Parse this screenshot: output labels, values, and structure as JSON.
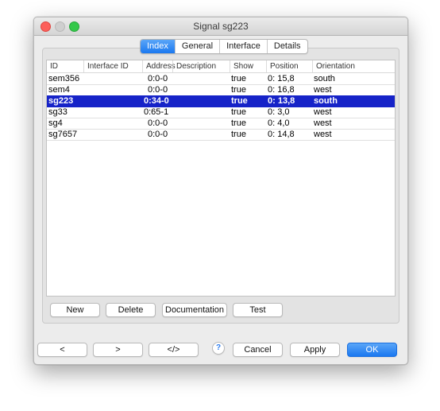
{
  "window": {
    "title": "Signal sg223"
  },
  "tabs": [
    {
      "label": "Index",
      "active": true
    },
    {
      "label": "General",
      "active": false
    },
    {
      "label": "Interface",
      "active": false
    },
    {
      "label": "Details",
      "active": false
    }
  ],
  "table": {
    "columns": [
      "ID",
      "Interface ID",
      "Address",
      "Description",
      "Show",
      "Position",
      "Orientation"
    ],
    "rows": [
      {
        "id": "sem356",
        "interface_id": "",
        "address": "0:0-0",
        "description": "",
        "show": "true",
        "position": "0: 15,8",
        "orientation": "south",
        "selected": false
      },
      {
        "id": "sem4",
        "interface_id": "",
        "address": "0:0-0",
        "description": "",
        "show": "true",
        "position": "0: 16,8",
        "orientation": "west",
        "selected": false
      },
      {
        "id": "sg223",
        "interface_id": "",
        "address": "0:34-0",
        "description": "",
        "show": "true",
        "position": "0: 13,8",
        "orientation": "south",
        "selected": true
      },
      {
        "id": "sg33",
        "interface_id": "",
        "address": "0:65-1",
        "description": "",
        "show": "true",
        "position": "0: 3,0",
        "orientation": "west",
        "selected": false
      },
      {
        "id": "sg4",
        "interface_id": "",
        "address": "0:0-0",
        "description": "",
        "show": "true",
        "position": "0: 4,0",
        "orientation": "west",
        "selected": false
      },
      {
        "id": "sg7657",
        "interface_id": "",
        "address": "0:0-0",
        "description": "",
        "show": "true",
        "position": "0: 14,8",
        "orientation": "west",
        "selected": false
      }
    ]
  },
  "table_actions": {
    "new": "New",
    "delete": "Delete",
    "documentation": "Documentation",
    "test": "Test"
  },
  "footer": {
    "prev": "<",
    "next": ">",
    "code": "</>",
    "help": "?",
    "cancel": "Cancel",
    "apply": "Apply",
    "ok": "OK"
  },
  "colors": {
    "accent": "#1a78f0",
    "selection": "#1623c8"
  }
}
